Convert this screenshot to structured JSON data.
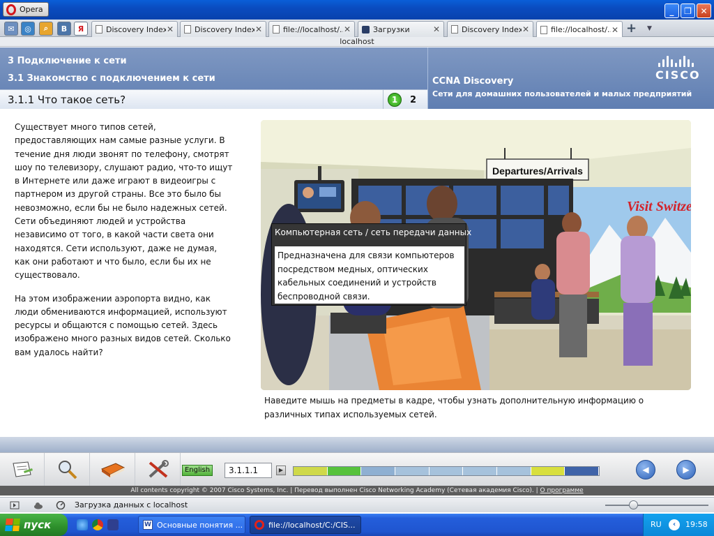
{
  "browser": {
    "menu_label": "Opera",
    "tabs": [
      {
        "label": "Discovery Index",
        "active": false
      },
      {
        "label": "Discovery Index",
        "active": false
      },
      {
        "label": "file://localhost/...",
        "active": false
      },
      {
        "label": "Загрузки",
        "active": false
      },
      {
        "label": "Discovery Index",
        "active": false
      },
      {
        "label": "file://localhost/...",
        "active": true
      }
    ],
    "address": "localhost",
    "status_text": "Загрузка данных с localhost"
  },
  "course": {
    "chapter": "3 Подключение к сети",
    "section": "3.1 Знакомство с подключением к сети",
    "topic": "3.1.1 Что такое сеть?",
    "product": "CCNA Discovery",
    "product_subtitle": "Сети для домашних пользователей и малых предприятий",
    "brand": "CISCO",
    "pages": [
      "1",
      "2"
    ]
  },
  "content": {
    "paragraph1": "Существует много типов сетей, предоставляющих нам самые разные услуги. В течение дня люди звонят по телефону, смотрят шоу по телевизору, слушают радио, что-то ищут в Интернете или даже играют в видеоигры с партнером из другой страны. Все это было бы невозможно, если бы не было надежных сетей. Сети объединяют людей и устройства независимо от того, в какой части света они находятся. Сети используют, даже не думая, как они работают и что было, если бы их не существовало.",
    "paragraph2": "На этом изображении аэропорта видно, как люди обмениваются информацией, используют ресурсы и общаются с помощью сетей. Здесь изображено много разных видов сетей. Сколько вам удалось найти?",
    "caption": "Наведите мышь на предметы в кадре, чтобы узнать дополнительную информацию о различных типах используемых сетей.",
    "sign": "Departures/Arrivals",
    "poster": "Visit Switzerland",
    "tooltip_title": "Компьютерная сеть / сеть передачи данных",
    "tooltip_text": "Предназначена для связи компьютеров посредством медных, оптических кабельных соединений и устройств беспроводной связи."
  },
  "toolbar": {
    "language": "English",
    "page_number": "3.1.1.1",
    "progress_colors": [
      "#cfd94a",
      "#57c23d",
      "#8fb0d2",
      "#a6c2dc",
      "#a6c2dc",
      "#a6c2dc",
      "#a6c2dc",
      "#d8df3e",
      "#3f63a8"
    ]
  },
  "footer": {
    "copyright": "All contents copyright © 2007 Cisco Systems, Inc. | Перевод выполнен Cisco Networking Academy (Сетевая академия Cisco). | ",
    "about": "О программе"
  },
  "taskbar": {
    "start_label": "пуск",
    "tasks": [
      {
        "label": "Основные понятия ...",
        "active": false
      },
      {
        "label": "file://localhost/C:/CIS...",
        "active": true
      }
    ],
    "lang": "RU",
    "time": "19:58"
  }
}
